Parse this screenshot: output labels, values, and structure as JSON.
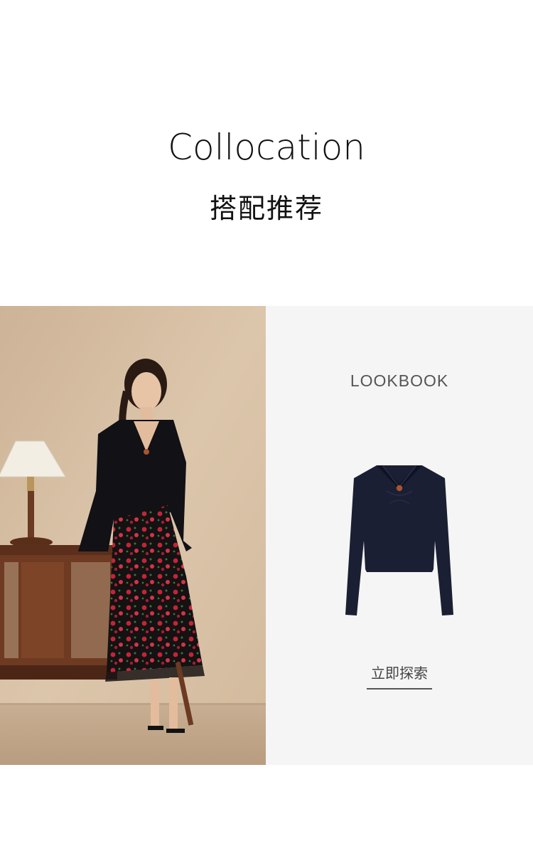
{
  "header": {
    "title_en": "Collocation",
    "title_cn": "搭配推荐"
  },
  "lookbook": {
    "label": "LOOKBOOK",
    "cta_label": "立即探索"
  },
  "colors": {
    "panel_bg": "#f5f5f5",
    "photo_wall": "#d9c3a8",
    "top_color": "#1b1f33",
    "skirt_color": "#1a1414",
    "flower_color": "#c0263a"
  }
}
